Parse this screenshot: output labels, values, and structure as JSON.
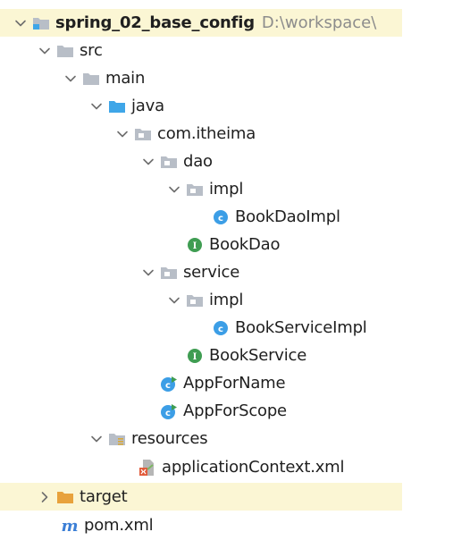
{
  "project": {
    "name": "spring_02_base_config",
    "path": "D:\\workspace\\"
  },
  "tree": {
    "src": "src",
    "main": "main",
    "java": "java",
    "package": "com.itheima",
    "dao": "dao",
    "dao_impl": "impl",
    "book_dao_impl": "BookDaoImpl",
    "book_dao": "BookDao",
    "service": "service",
    "service_impl": "impl",
    "book_service_impl": "BookServiceImpl",
    "book_service": "BookService",
    "app_for_name": "AppForName",
    "app_for_scope": "AppForScope",
    "resources": "resources",
    "app_context": "applicationContext.xml",
    "target": "target",
    "pom": "pom.xml"
  },
  "colors": {
    "folder": "#b8bec7",
    "source_folder": "#3fa6e8",
    "target_folder": "#e8a23c",
    "class_icon": "#3c9ee6",
    "interface_icon": "#3f9d52",
    "selection_bg": "#fbf6d4"
  }
}
